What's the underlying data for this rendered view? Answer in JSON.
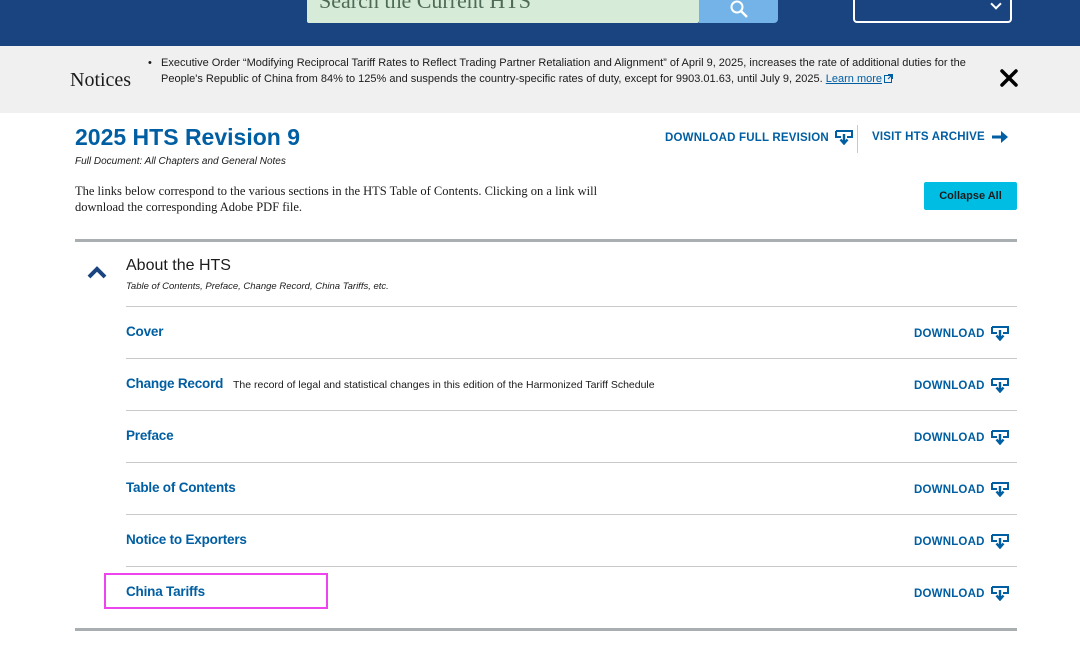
{
  "header": {
    "search_placeholder": "Search the Current HTS"
  },
  "notices": {
    "label": "Notices",
    "bullet": "•",
    "text": "Executive Order “Modifying Reciprocal Tariff Rates to Reflect Trading Partner Retaliation and Alignment” of April 9, 2025, increases the rate of additional duties for the People's Republic of China from 84% to 125% and suspends the country-specific rates of duty, except for 9903.01.63, until July 9, 2025.",
    "link": "Learn more"
  },
  "revision": {
    "title": "2025 HTS Revision 9",
    "subtitle": "Full Document: All Chapters and General Notes",
    "download_full": "DOWNLOAD FULL REVISION",
    "visit_archive": "VISIT HTS ARCHIVE",
    "intro": "The links below correspond to the various sections in the HTS Table of Contents. Clicking on a link will download the corresponding Adobe PDF file.",
    "collapse_all": "Collapse All"
  },
  "accordion": {
    "title": "About the HTS",
    "subtitle": "Table of Contents, Preface, Change Record, China Tariffs, etc.",
    "items": [
      {
        "title": "Cover",
        "desc": "",
        "download": "DOWNLOAD"
      },
      {
        "title": "Change Record",
        "desc": "The record of legal and statistical changes in this edition of the Harmonized Tariff Schedule",
        "download": "DOWNLOAD"
      },
      {
        "title": "Preface",
        "desc": "",
        "download": "DOWNLOAD"
      },
      {
        "title": "Table of Contents",
        "desc": "",
        "download": "DOWNLOAD"
      },
      {
        "title": "Notice to Exporters",
        "desc": "",
        "download": "DOWNLOAD"
      },
      {
        "title": "China Tariffs",
        "desc": "",
        "download": "DOWNLOAD"
      }
    ]
  },
  "colors": {
    "header_bg": "#1a4480",
    "link_blue": "#005ea2",
    "button_cyan": "#00bde3",
    "highlight": "#ee44ee"
  },
  "icons": {
    "search": "search-icon",
    "close": "close-icon",
    "download": "download-icon",
    "arrow": "arrow-right-icon",
    "chevron": "chevron-up-icon",
    "external": "external-link-icon"
  }
}
